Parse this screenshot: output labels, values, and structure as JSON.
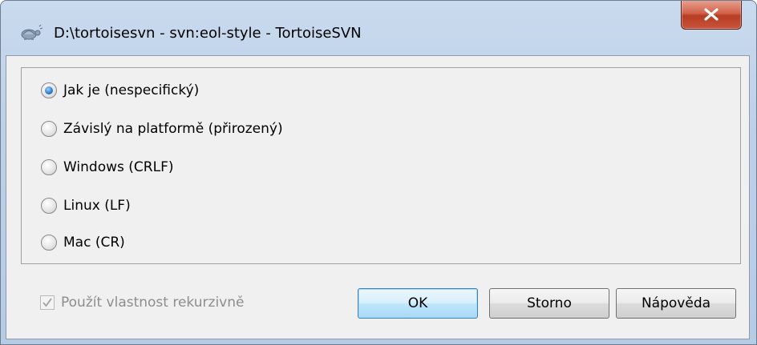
{
  "window": {
    "title": "D:\\tortoisesvn - svn:eol-style - TortoiseSVN",
    "app_icon": "tortoise-icon",
    "close_icon": "close-icon"
  },
  "eol_options": {
    "items": [
      {
        "label": "Jak je (nespecifický)",
        "checked": true
      },
      {
        "label": "Závislý na platformě (přirozený)",
        "checked": false
      },
      {
        "label": "Windows (CRLF)",
        "checked": false
      },
      {
        "label": "Linux (LF)",
        "checked": false
      },
      {
        "label": "Mac (CR)",
        "checked": false
      }
    ]
  },
  "recursive": {
    "label": "Použít vlastnost rekurzivně",
    "checked": true,
    "enabled": false
  },
  "buttons": {
    "ok": "OK",
    "cancel": "Storno",
    "help": "Nápověda"
  },
  "colors": {
    "title_bar": "#bcd0e8",
    "close_button": "#c8553c",
    "dialog_background": "#f0f0f0",
    "default_button": "#bee6fd"
  }
}
